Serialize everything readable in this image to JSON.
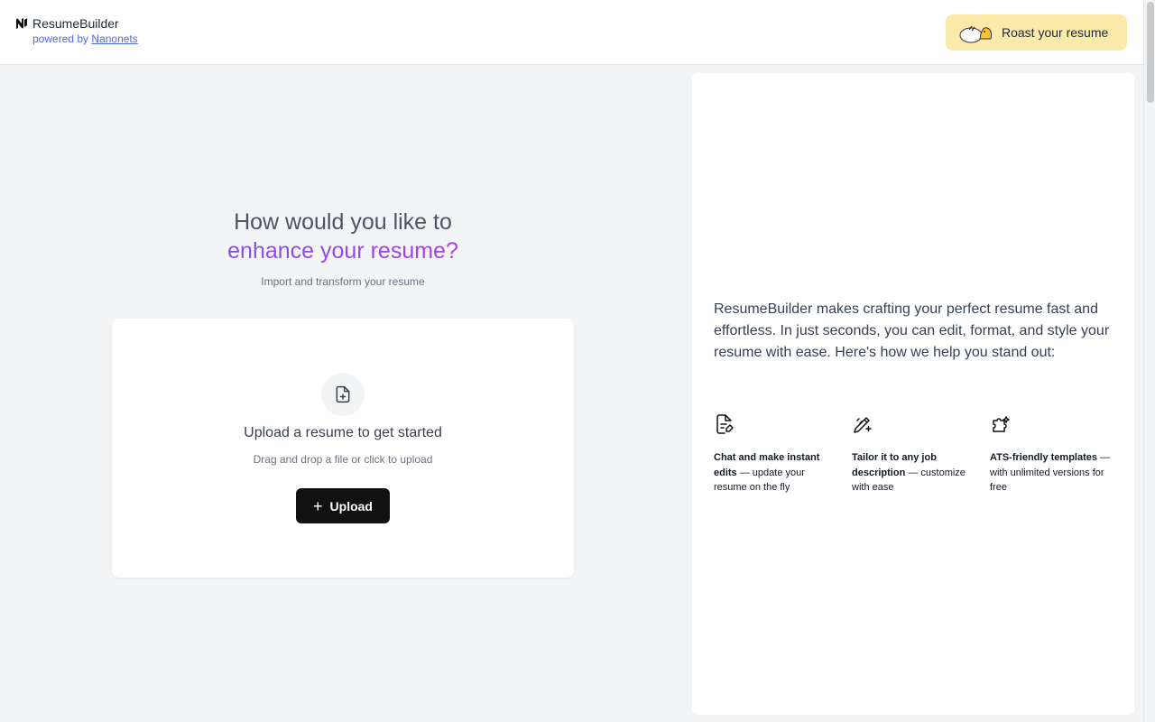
{
  "header": {
    "brand_name": "ResumeBuilder",
    "powered_prefix": "powered by",
    "powered_link": "Nanonets",
    "roast_label": "Roast your resume"
  },
  "hero": {
    "line1": "How would you like to",
    "line2": "enhance your resume?",
    "subtitle": "Import and transform your resume"
  },
  "upload_card": {
    "title": "Upload a resume to get started",
    "subtitle": "Drag and drop a file or click to upload",
    "button_label": "Upload"
  },
  "info_panel": {
    "intro": "ResumeBuilder makes crafting your perfect resume fast and effortless. In just seconds, you can edit, format, and style your resume with ease. Here's how we help you stand out:",
    "features": [
      {
        "icon": "file-edit-icon",
        "bold": "Chat and make instant edits",
        "rest": " — update your resume on the fly"
      },
      {
        "icon": "pencil-ruler-icon",
        "bold": "Tailor it to any job description",
        "rest": " — customize with ease"
      },
      {
        "icon": "puzzle-icon",
        "bold": "ATS-friendly templates",
        "rest": " — with unlimited versions for free"
      }
    ]
  },
  "colors": {
    "accent_start": "#5f68e6",
    "accent_end": "#c93fe0",
    "roast_bg": "#fbeaa9",
    "button_bg": "#111111"
  }
}
